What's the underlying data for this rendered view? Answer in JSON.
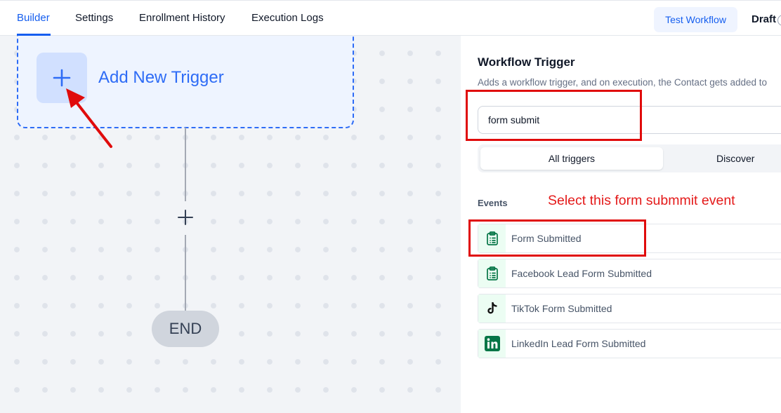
{
  "tabs": [
    {
      "label": "Builder",
      "active": true
    },
    {
      "label": "Settings"
    },
    {
      "label": "Enrollment History"
    },
    {
      "label": "Execution Logs"
    }
  ],
  "header": {
    "test_workflow_label": "Test Workflow",
    "status_label": "Draft"
  },
  "canvas": {
    "trigger_title": "Add New Trigger",
    "end_label": "END"
  },
  "panel": {
    "title": "Workflow Trigger",
    "description": "Adds a workflow trigger, and on execution, the Contact gets added to",
    "search_value": "form submit",
    "segments": [
      "All triggers",
      "Discover"
    ],
    "events_heading": "Events",
    "events": [
      {
        "label": "Form Submitted",
        "icon": "clipboard-list-icon"
      },
      {
        "label": "Facebook Lead Form Submitted",
        "icon": "clipboard-list-icon"
      },
      {
        "label": "TikTok Form Submitted",
        "icon": "tiktok-icon"
      },
      {
        "label": "LinkedIn Lead Form Submitted",
        "icon": "linkedin-icon"
      }
    ]
  },
  "annotation": {
    "note": "Select this form submmit event"
  },
  "colors": {
    "accent": "#155eef",
    "annotation_red": "#e00b0b",
    "event_icon_green": "#067647"
  }
}
